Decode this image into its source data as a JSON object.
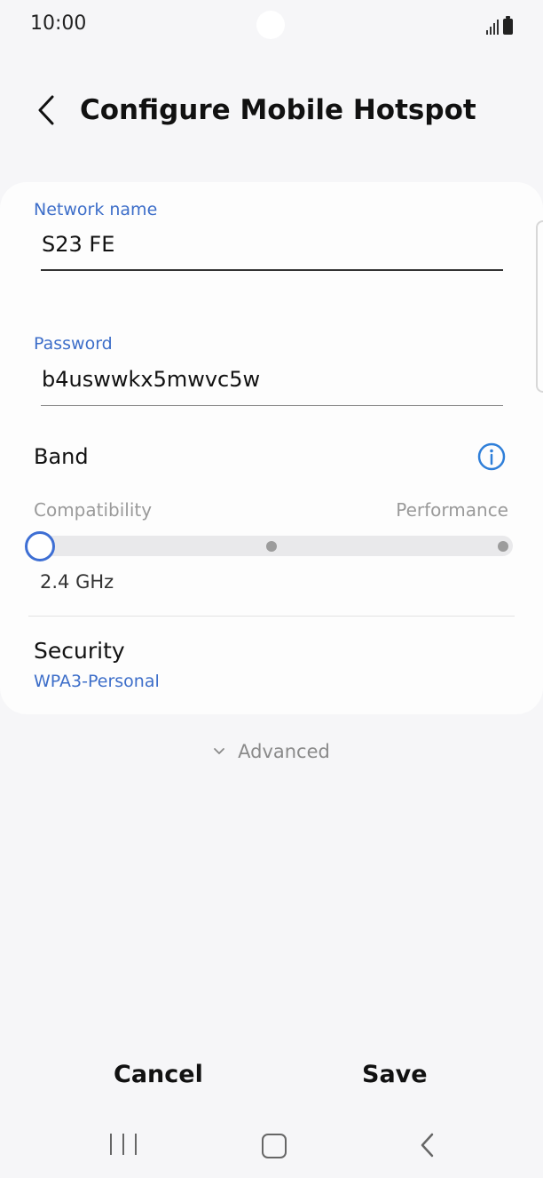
{
  "status_bar": {
    "time": "10:00",
    "icons": [
      "signal-icon",
      "battery-icon"
    ]
  },
  "header": {
    "title": "Configure Mobile Hotspot",
    "back_icon": "back-arrow-icon"
  },
  "form": {
    "network_name": {
      "label": "Network name",
      "value": "S23 FE"
    },
    "password": {
      "label": "Password",
      "value": "b4uswwkx5mwvc5w"
    },
    "band": {
      "label": "Band",
      "left_label": "Compatibility",
      "right_label": "Performance",
      "selected_step": 0,
      "steps": 3,
      "value": "2.4 GHz",
      "info_icon": "info-icon"
    },
    "security": {
      "label": "Security",
      "value": "WPA3-Personal"
    }
  },
  "advanced": {
    "label": "Advanced"
  },
  "actions": {
    "cancel": "Cancel",
    "save": "Save"
  },
  "colors": {
    "accent": "#3d6ec9",
    "background": "#f6f6f8",
    "card": "#fdfdfd"
  }
}
